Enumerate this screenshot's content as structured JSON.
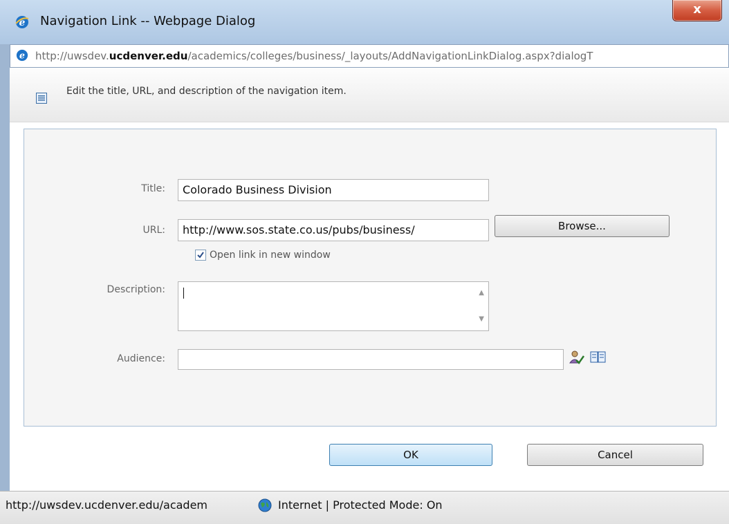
{
  "window": {
    "title": "Navigation Link -- Webpage Dialog",
    "close_label": "x"
  },
  "address": {
    "prefix": "http://uwsdev.",
    "domain": "ucdenver.edu",
    "path": "/academics/colleges/business/_layouts/AddNavigationLinkDialog.aspx?dialogT"
  },
  "info": {
    "message": "Edit the title, URL, and description of the navigation item."
  },
  "form": {
    "title_label": "Title:",
    "title_value": "Colorado Business Division",
    "url_label": "URL:",
    "url_value": "http://www.sos.state.co.us/pubs/business/",
    "browse_label": "Browse...",
    "new_window_label": "Open link in new window",
    "new_window_checked": true,
    "description_label": "Description:",
    "description_value": "",
    "audience_label": "Audience:",
    "audience_value": ""
  },
  "buttons": {
    "ok": "OK",
    "cancel": "Cancel"
  },
  "status": {
    "url": "http://uwsdev.ucdenver.edu/academ",
    "zone": "Internet | Protected Mode: On"
  },
  "colors": {
    "titlebar": "#bcd2ea",
    "close_button": "#d55e43",
    "panel_border": "#a7bed5",
    "ok_button": "#bfe0f7"
  },
  "icons": [
    "ie-logo-icon",
    "close-icon",
    "list-icon",
    "checkbox-checked-icon",
    "check-names-icon",
    "address-book-icon",
    "globe-icon"
  ]
}
